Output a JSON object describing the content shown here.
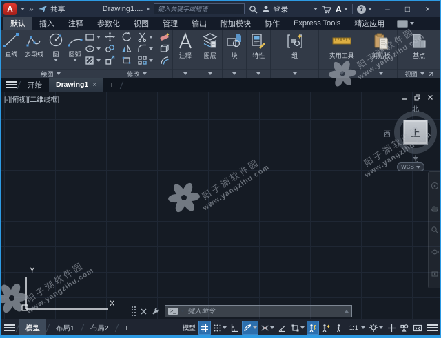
{
  "colors": {
    "window_border": "#2d9ae3",
    "titlebar_bg": "#232d3f",
    "ribbon_bg": "#323a47",
    "canvas_bg": "#151b24",
    "active_highlight": "#2c6fae",
    "app_badge_red": "#c2271f",
    "accent_icon_blue": "#6fb0e2"
  },
  "title_bar": {
    "app_badge": "A",
    "quick_expand": "»",
    "share_label": "共享",
    "doc_title": "Drawing1....",
    "search_placeholder": "键入关键字或短语",
    "login_label": "登录",
    "apps_badge": "A",
    "help_badge": "?",
    "window_buttons": {
      "minimize": "–",
      "maximize": "□",
      "close": "×"
    }
  },
  "ribbon_tabs": [
    {
      "label": "默认",
      "active": true
    },
    {
      "label": "插入"
    },
    {
      "label": "注释"
    },
    {
      "label": "参数化"
    },
    {
      "label": "视图"
    },
    {
      "label": "管理"
    },
    {
      "label": "输出"
    },
    {
      "label": "附加模块"
    },
    {
      "label": "协作"
    },
    {
      "label": "Express Tools"
    },
    {
      "label": "精选应用"
    }
  ],
  "ribbon": {
    "draw_panel": {
      "label": "绘图",
      "buttons": [
        {
          "label": "直线"
        },
        {
          "label": "多段线"
        },
        {
          "label": "圆"
        },
        {
          "label": "圆弧"
        }
      ]
    },
    "modify_panel": {
      "label": "修改"
    },
    "annotate_panel": {
      "label": "注释"
    },
    "layers_panel": {
      "label": "图层"
    },
    "block_panel": {
      "label": "块"
    },
    "properties_panel": {
      "label": "特性"
    },
    "groups_panel": {
      "label": "组"
    },
    "utilities_panel": {
      "label": "实用工具"
    },
    "clipboard_panel": {
      "label": "剪贴板"
    },
    "view_panel": {
      "label": "视图",
      "base_button": "基点"
    }
  },
  "file_tabs": {
    "start": "开始",
    "active_doc": "Drawing1",
    "close": "×",
    "new_tab": "+"
  },
  "viewport": {
    "label": "[-][俯视][二维线框]",
    "viewcube": {
      "north": "北",
      "south": "南",
      "east": "东",
      "west": "西",
      "top": "上"
    },
    "wcs": "WCS",
    "ucs": {
      "x": "X",
      "y": "Y"
    }
  },
  "command_line": {
    "placeholder": "键入命令"
  },
  "watermark": {
    "title": "阳子湖软件园",
    "url": "www.yangzihu.com"
  },
  "status_bar": {
    "layout_tabs": [
      {
        "label": "模型",
        "active": true
      },
      {
        "label": "布局1"
      },
      {
        "label": "布局2"
      }
    ],
    "new_layout": "+",
    "space_label": "模型",
    "annotation_scale": "1:1"
  }
}
